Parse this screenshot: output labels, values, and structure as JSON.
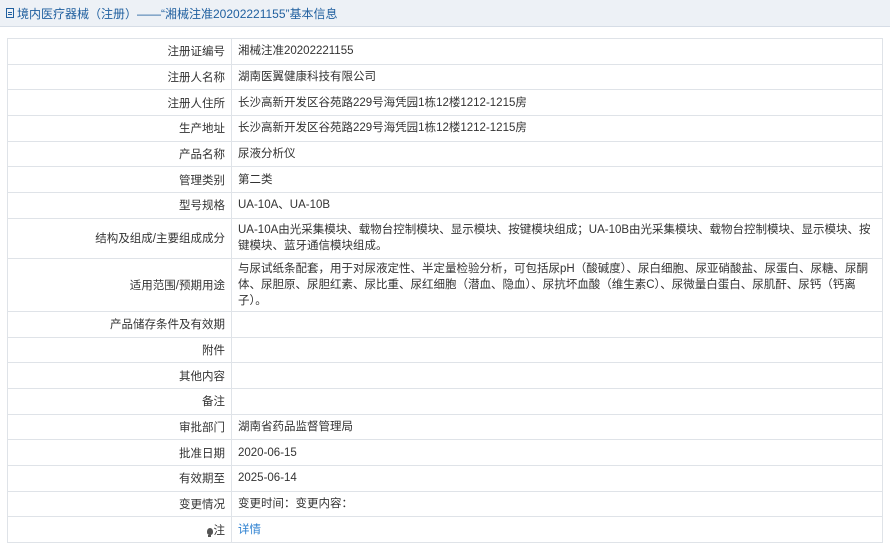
{
  "header": {
    "title": "境内医疗器械（注册）——“湘械注准20202221155”基本信息"
  },
  "fields": {
    "reg_no_label": "注册证编号",
    "reg_no": "湘械注准20202221155",
    "registrant_label": "注册人名称",
    "registrant": "湖南医翼健康科技有限公司",
    "registrant_addr_label": "注册人住所",
    "registrant_addr": "长沙高新开发区谷苑路229号海凭园1栋12楼1212-1215房",
    "prod_addr_label": "生产地址",
    "prod_addr": "长沙高新开发区谷苑路229号海凭园1栋12楼1212-1215房",
    "product_name_label": "产品名称",
    "product_name": "尿液分析仪",
    "category_label": "管理类别",
    "category": "第二类",
    "model_label": "型号规格",
    "model": "UA-10A、UA-10B",
    "structure_label": "结构及组成/主要组成成分",
    "structure": "UA-10A由光采集模块、载物台控制模块、显示模块、按键模块组成；UA-10B由光采集模块、载物台控制模块、显示模块、按键模块、蓝牙通信模块组成。",
    "usage_label": "适用范围/预期用途",
    "usage": "与尿试纸条配套，用于对尿液定性、半定量检验分析，可包括尿pH（酸碱度）、尿白细胞、尿亚硝酸盐、尿蛋白、尿糖、尿酮体、尿胆原、尿胆红素、尿比重、尿红细胞（潜血、隐血）、尿抗坏血酸（维生素C）、尿微量白蛋白、尿肌酐、尿钙（钙离子）。",
    "storage_label": "产品储存条件及有效期",
    "storage": "",
    "attachment_label": "附件",
    "attachment": "",
    "other_label": "其他内容",
    "other": "",
    "remark_label": "备注",
    "remark": "",
    "approver_label": "审批部门",
    "approver": "湖南省药品监督管理局",
    "approve_date_label": "批准日期",
    "approve_date": "2020-06-15",
    "valid_until_label": "有效期至",
    "valid_until": "2025-06-14",
    "change_label": "变更情况",
    "change": "变更时间：变更内容：",
    "note_label": "注",
    "note_link": "详情"
  },
  "icons": {
    "title_icon": "document-icon",
    "note_icon": "lightbulb-icon"
  }
}
